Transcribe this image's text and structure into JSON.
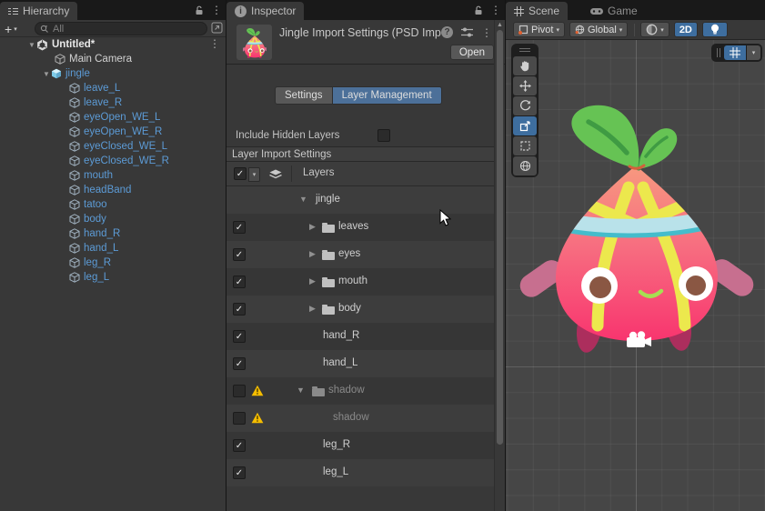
{
  "icons": {
    "foldout_open": "▼",
    "foldout_closed": "▶",
    "dropdown": "▾",
    "plus": "+",
    "kebab": "⋮",
    "check": "✓",
    "scroll_up": "▲"
  },
  "hierarchy": {
    "tab": "Hierarchy",
    "search_placeholder": "All",
    "items": [
      {
        "label": "Untitled*",
        "kind": "scene"
      },
      {
        "label": "Main Camera",
        "kind": "gameobject"
      },
      {
        "label": "jingle",
        "kind": "prefab"
      },
      {
        "label": "leave_L",
        "kind": "prefab-child"
      },
      {
        "label": "leave_R",
        "kind": "prefab-child"
      },
      {
        "label": "eyeOpen_WE_L",
        "kind": "prefab-child"
      },
      {
        "label": "eyeOpen_WE_R",
        "kind": "prefab-child"
      },
      {
        "label": "eyeClosed_WE_L",
        "kind": "prefab-child"
      },
      {
        "label": "eyeClosed_WE_R",
        "kind": "prefab-child"
      },
      {
        "label": "mouth",
        "kind": "prefab-child"
      },
      {
        "label": "headBand",
        "kind": "prefab-child"
      },
      {
        "label": "tatoo",
        "kind": "prefab-child"
      },
      {
        "label": "body",
        "kind": "prefab-child"
      },
      {
        "label": "hand_R",
        "kind": "prefab-child"
      },
      {
        "label": "hand_L",
        "kind": "prefab-child"
      },
      {
        "label": "leg_R",
        "kind": "prefab-child"
      },
      {
        "label": "leg_L",
        "kind": "prefab-child"
      }
    ]
  },
  "inspector": {
    "tab": "Inspector",
    "title": "Jingle Import Settings (PSD Imp",
    "open_label": "Open",
    "tabs": {
      "settings": "Settings",
      "layer_management": "Layer Management"
    },
    "active_tab": "Layer Management",
    "include_hidden_label": "Include Hidden Layers",
    "include_hidden_checked": false,
    "section_title": "Layer Import Settings",
    "column_label": "Layers",
    "rows": [
      {
        "label": "jingle",
        "type": "root",
        "expanded": true
      },
      {
        "label": "leaves",
        "type": "group",
        "checked": true
      },
      {
        "label": "eyes",
        "type": "group",
        "checked": true
      },
      {
        "label": "mouth",
        "type": "group",
        "checked": true
      },
      {
        "label": "body",
        "type": "group",
        "checked": true
      },
      {
        "label": "hand_R",
        "type": "layer",
        "checked": true
      },
      {
        "label": "hand_L",
        "type": "layer",
        "checked": true
      },
      {
        "label": "shadow",
        "type": "group",
        "checked": false,
        "warning": true,
        "expanded": true
      },
      {
        "label": "shadow",
        "type": "layer",
        "checked": false,
        "warning": true
      },
      {
        "label": "leg_R",
        "type": "layer",
        "checked": true
      },
      {
        "label": "leg_L",
        "type": "layer",
        "checked": true
      }
    ]
  },
  "scene": {
    "tab_scene": "Scene",
    "tab_game": "Game",
    "toolbar": {
      "pivot": "Pivot",
      "global": "Global",
      "mode_2d": "2D"
    },
    "tools": [
      "hand",
      "move",
      "rotate",
      "scale",
      "rect",
      "transform"
    ],
    "active_tool": "scale"
  },
  "colors": {
    "accent_blue": "#3E6E9F",
    "selected_tab_blue": "#4C7099",
    "warning_yellow": "#F5BD00",
    "prefab_text": "#5C9BD6",
    "body_top": "#F7997F",
    "body_bottom": "#F8336E",
    "stripe_yellow": "#ECE84D",
    "band_blue": "#B9E2EA",
    "band_edge": "#45BCCB",
    "leaf_green": "#66C354",
    "leaf_vein": "#3F9B43",
    "iris_brown": "#8A5743",
    "arm_pink": "#C76F8F",
    "leg_crimson": "#AC2E5D"
  }
}
